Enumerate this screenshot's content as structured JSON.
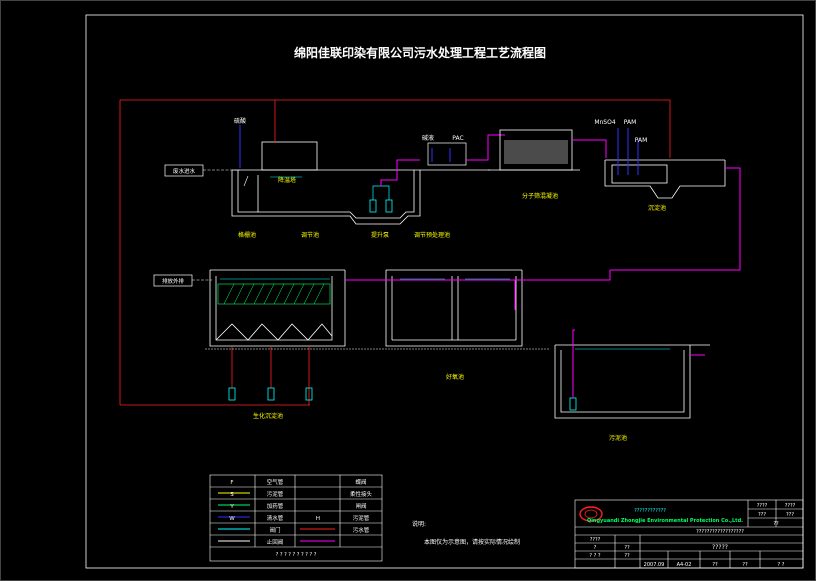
{
  "title": "绵阳佳联印染有限公司污水处理工程工艺流程图",
  "labels": {
    "inlet": "废水进水",
    "outlet": "排放外排",
    "grid_tank": "格栅池",
    "regulating_tank": "调节池",
    "lift_pump": "提升泵",
    "cooling_tower": "降温塔",
    "equalization_inner": "调节预处理池",
    "polymer_tank": "分子筛混凝池",
    "settling_tank": "沉淀池",
    "biofilm_tank": "生化沉淀池",
    "oxidation_tank": "好氧池",
    "sludge_tank": "污泥池",
    "reagent_1": "硫酸",
    "reagent_2": "碱液",
    "reagent_3": "PAC",
    "reagent_4": "PAM",
    "reagent_5": "MnSO4",
    "reagent_6": "PAM"
  },
  "legend": {
    "rows": [
      {
        "sym": "F",
        "name": "空气管",
        "sym2": "",
        "name2": "蝶阀"
      },
      {
        "sym": "S",
        "name": "污泥管",
        "sym2": "",
        "name2": "柔性接头"
      },
      {
        "sym": "Y",
        "name": "加药管",
        "sym2": "",
        "name2": "闸阀"
      },
      {
        "sym": "W",
        "name": "清水管",
        "sym2": "H",
        "name2": "污泥管"
      },
      {
        "sym": "",
        "name": "阀门",
        "sym2": "",
        "name2": "污水管"
      },
      {
        "sym": "",
        "name": "止回阀",
        "sym2": "",
        "name2": ""
      }
    ],
    "footer": "? ? ? ? ? ? ? ? ? ?"
  },
  "notes": {
    "heading": "说明:",
    "text": "本图仅为示意图，请按实际情况绘制"
  },
  "title_block": {
    "company_cn": "????????????",
    "company_en": "Qingyuandi Zhongjie Environmental Protection Co.,Ltd.",
    "drawing_name": "?????",
    "placeholder_row": "??????????????????",
    "fields": [
      "????",
      "2007.09",
      "A4-02",
      "??",
      "??",
      "?",
      "??",
      "??",
      "? ? ?",
      "? ?"
    ],
    "right_top": [
      "????",
      "????",
      "???",
      "???",
      "??"
    ]
  }
}
